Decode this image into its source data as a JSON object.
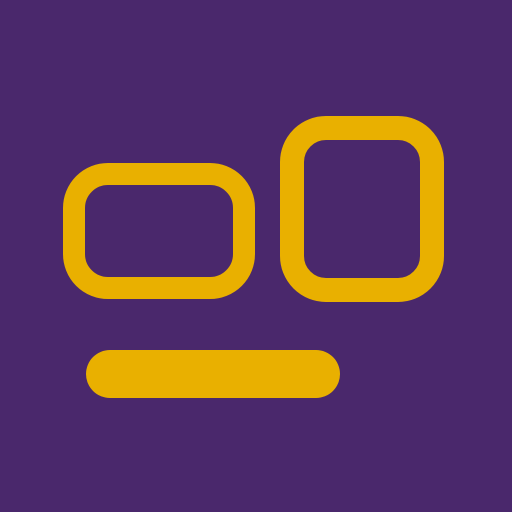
{
  "icon": {
    "semantic": "two-windows-with-bar-logo",
    "colors": {
      "background": "#4a286c",
      "accent": "#e9b000"
    }
  }
}
